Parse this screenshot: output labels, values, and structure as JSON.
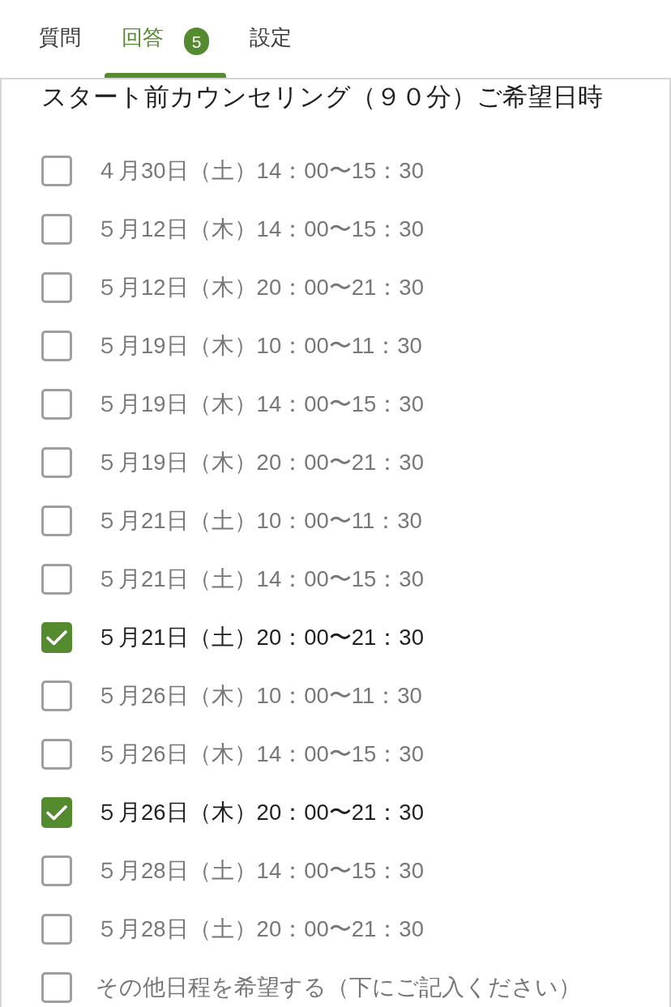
{
  "tabs": [
    {
      "label": "質問",
      "selected": false
    },
    {
      "label": "回答",
      "selected": true,
      "badge": "5"
    },
    {
      "label": "設定",
      "selected": false
    }
  ],
  "question": {
    "title": "スタート前カウンセリング（９０分）ご希望日時",
    "options": [
      {
        "label": "４月30日（土）14：00〜15：30",
        "checked": false
      },
      {
        "label": "５月12日（木）14：00〜15：30",
        "checked": false
      },
      {
        "label": "５月12日（木）20：00〜21：30",
        "checked": false
      },
      {
        "label": "５月19日（木）10：00〜11：30",
        "checked": false
      },
      {
        "label": "５月19日（木）14：00〜15：30",
        "checked": false
      },
      {
        "label": "５月19日（木）20：00〜21：30",
        "checked": false
      },
      {
        "label": "５月21日（土）10：00〜11：30",
        "checked": false
      },
      {
        "label": "５月21日（土）14：00〜15：30",
        "checked": false
      },
      {
        "label": "５月21日（土）20：00〜21：30",
        "checked": true
      },
      {
        "label": "５月26日（木）10：00〜11：30",
        "checked": false
      },
      {
        "label": "５月26日（木）14：00〜15：30",
        "checked": false
      },
      {
        "label": "５月26日（木）20：00〜21：30",
        "checked": true
      },
      {
        "label": "５月28日（土）14：00〜15：30",
        "checked": false
      },
      {
        "label": "５月28日（土）20：00〜21：30",
        "checked": false
      },
      {
        "label": "その他日程を希望する（下にご記入ください）",
        "checked": false
      }
    ]
  }
}
